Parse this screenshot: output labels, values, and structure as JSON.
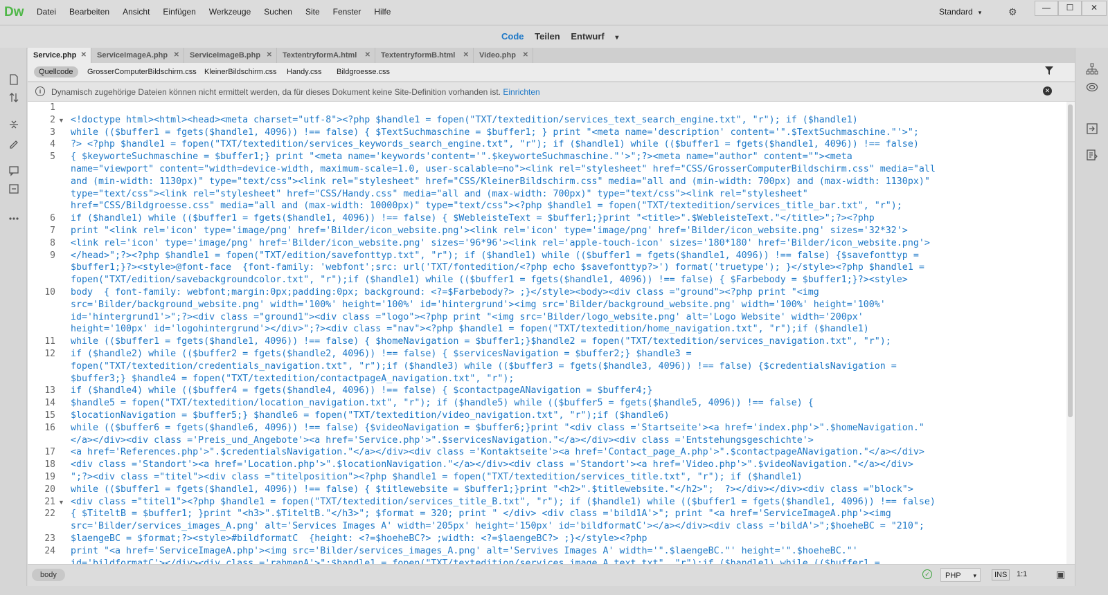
{
  "app": {
    "logo": "Dw"
  },
  "menu": [
    "Datei",
    "Bearbeiten",
    "Ansicht",
    "Einfügen",
    "Werkzeuge",
    "Suchen",
    "Site",
    "Fenster",
    "Hilfe"
  ],
  "workspace": {
    "label": "Standard",
    "caret": "▾",
    "sync_icon": "⚙"
  },
  "window_controls": {
    "minimize": "—",
    "maximize": "☐",
    "close": "✕"
  },
  "view_modes": {
    "code": "Code",
    "split": "Teilen",
    "design": "Entwurf",
    "caret": "▾"
  },
  "tabs": [
    {
      "label": "Service.php",
      "close": "✕"
    },
    {
      "label": "ServiceImageA.php",
      "close": "✕"
    },
    {
      "label": "ServiceImageB.php",
      "close": "✕"
    },
    {
      "label": "TextentryformA.html",
      "close": "✕"
    },
    {
      "label": "TextentryformB.html",
      "close": "✕"
    },
    {
      "label": "Video.php",
      "close": "✕"
    }
  ],
  "related_files": [
    "Quellcode",
    "GrosserComputerBildschirm.css",
    "KleinerBildschirm.css",
    "Handy.css",
    "Bildgroesse.css"
  ],
  "info_bar": {
    "icon": "i",
    "message": "Dynamisch zugehörige Dateien können nicht ermittelt werden, da für dieses Dokument keine Site-Definition vorhanden ist.",
    "link": "Einrichten",
    "close": "✕"
  },
  "code_lines": [
    {
      "num": "1",
      "fold": "",
      "text": ""
    },
    {
      "num": "2",
      "fold": "▼",
      "text": "<!doctype html><html><head><meta charset=\"utf-8\"><?php $handle1 = fopen(\"TXT/textedition/services_text_search_engine.txt\", \"r\"); if ($handle1)"
    },
    {
      "num": "3",
      "fold": "",
      "text": "while (($buffer1 = fgets($handle1, 4096)) !== false) { $TextSuchmaschine = $buffer1; } print \"<meta name='description' content='\".$TextSuchmaschine.\"'>\";"
    },
    {
      "num": "4",
      "fold": "",
      "text": "?> <?php $handle1 = fopen(\"TXT/textedition/services_keywords_search_engine.txt\", \"r\"); if ($handle1) while (($buffer1 = fgets($handle1, 4096)) !== false)"
    },
    {
      "num": "5",
      "fold": "",
      "text": "{ $keyworteSuchmaschine = $buffer1;} print \"<meta name='keywords'content='\".$keyworteSuchmaschine.\"'>\";?><meta name=\"author\" content=\"\"><meta"
    },
    {
      "num": "",
      "fold": "",
      "text": "name=\"viewport\" content=\"width=device-width, maximum-scale=1.0, user-scalable=no\"><link rel=\"stylesheet\" href=\"CSS/GrosserComputerBildschirm.css\" media=\"all"
    },
    {
      "num": "",
      "fold": "",
      "text": "and (min-width: 1130px)\" type=\"text/css\"><link rel=\"stylesheet\" href=\"CSS/KleinerBildschirm.css\" media=\"all and (min-width: 700px) and (max-width: 1130px)\""
    },
    {
      "num": "",
      "fold": "",
      "text": "type=\"text/css\"><link rel=\"stylesheet\" href=\"CSS/Handy.css\" media=\"all and (max-width: 700px)\" type=\"text/css\"><link rel=\"stylesheet\""
    },
    {
      "num": "",
      "fold": "",
      "text": "href=\"CSS/Bildgroesse.css\" media=\"all and (max-width: 10000px)\" type=\"text/css\"><?php $handle1 = fopen(\"TXT/textedition/services_title_bar.txt\", \"r\");"
    },
    {
      "num": "6",
      "fold": "",
      "text": "if ($handle1) while (($buffer1 = fgets($handle1, 4096)) !== false) { $WebleisteText = $buffer1;}print \"<title>\".$WebleisteText.\"</title>\";?><?php"
    },
    {
      "num": "7",
      "fold": "",
      "text": "print \"<link rel='icon' type='image/png' href='Bilder/icon_website.png'><link rel='icon' type='image/png' href='Bilder/icon_website.png' sizes='32*32'>"
    },
    {
      "num": "8",
      "fold": "",
      "text": "<link rel='icon' type='image/png' href='Bilder/icon_website.png' sizes='96*96'><link rel='apple-touch-icon' sizes='180*180' href='Bilder/icon_website.png'>"
    },
    {
      "num": "9",
      "fold": "",
      "text": "</head>\";?><?php $handle1 = fopen(\"TXT/edition/savefonttyp.txt\", \"r\"); if ($handle1) while (($buffer1 = fgets($handle1, 4096)) !== false) {$savefonttyp ="
    },
    {
      "num": "",
      "fold": "",
      "text": "$buffer1;}?><style>@font-face  {font-family: 'webfont';src: url('TXT/fontedition/<?php echo $savefonttyp?>') format('truetype'); }</style><?php $handle1 ="
    },
    {
      "num": "",
      "fold": "",
      "text": "fopen(\"TXT/edition/savebackgroundcolor.txt\", \"r\");if ($handle1) while (($buffer1 = fgets($handle1, 4096)) !== false) { $Farbebody = $buffer1;}?><style>"
    },
    {
      "num": "10",
      "fold": "",
      "text": "body  { font-family: webfont;margin:0px;padding:0px; background: <?=$Farbebody?> ;}</style><body><div class =\"ground\"><?php print \"<img"
    },
    {
      "num": "",
      "fold": "",
      "text": "src='Bilder/background_website.png' width='100%' height='100%' id='hintergrund'><img src='Bilder/background_website.png' width='100%' height='100%'"
    },
    {
      "num": "",
      "fold": "",
      "text": "id='hintergrund1'>\";?><div class =\"ground1\"><div class =\"logo\"><?php print \"<img src='Bilder/logo_website.png' alt='Logo Website' width='200px'"
    },
    {
      "num": "",
      "fold": "",
      "text": "height='100px' id='logohintergrund'></div>\";?><div class =\"nav\"><?php $handle1 = fopen(\"TXT/textedition/home_navigation.txt\", \"r\");if ($handle1)"
    },
    {
      "num": "11",
      "fold": "",
      "text": "while (($buffer1 = fgets($handle1, 4096)) !== false) { $homeNavigation = $buffer1;}$handle2 = fopen(\"TXT/textedition/services_navigation.txt\", \"r\");"
    },
    {
      "num": "12",
      "fold": "",
      "text": "if ($handle2) while (($buffer2 = fgets($handle2, 4096)) !== false) { $servicesNavigation = $buffer2;} $handle3 ="
    },
    {
      "num": "",
      "fold": "",
      "text": "fopen(\"TXT/textedition/credentials_navigation.txt\", \"r\");if ($handle3) while (($buffer3 = fgets($handle3, 4096)) !== false) {$credentialsNavigation ="
    },
    {
      "num": "",
      "fold": "",
      "text": "$buffer3;} $handle4 = fopen(\"TXT/textedition/contactpageA_navigation.txt\", \"r\");"
    },
    {
      "num": "13",
      "fold": "",
      "text": "if ($handle4) while (($buffer4 = fgets($handle4, 4096)) !== false) { $contactpageANavigation = $buffer4;}"
    },
    {
      "num": "14",
      "fold": "",
      "text": "$handle5 = fopen(\"TXT/textedition/location_navigation.txt\", \"r\"); if ($handle5) while (($buffer5 = fgets($handle5, 4096)) !== false) {"
    },
    {
      "num": "15",
      "fold": "",
      "text": "$locationNavigation = $buffer5;} $handle6 = fopen(\"TXT/textedition/video_navigation.txt\", \"r\");if ($handle6)"
    },
    {
      "num": "16",
      "fold": "",
      "text": "while (($buffer6 = fgets($handle6, 4096)) !== false) {$videoNavigation = $buffer6;}print \"<div class ='Startseite'><a href='index.php'>\".$homeNavigation.\""
    },
    {
      "num": "",
      "fold": "",
      "text": "</a></div><div class ='Preis_und_Angebote'><a href='Service.php'>\".$servicesNavigation.\"</a></div><div class ='Entstehungsgeschichte'>"
    },
    {
      "num": "17",
      "fold": "",
      "text": "<a href='References.php'>\".$credentialsNavigation.\"</a></div><div class ='Kontaktseite'><a href='Contact_page_A.php'>\".$contactpageANavigation.\"</a></div>"
    },
    {
      "num": "18",
      "fold": "",
      "text": "<div class ='Standort'><a href='Location.php'>\".$locationNavigation.\"</a></div><div class ='Standort'><a href='Video.php'>\".$videoNavigation.\"</a></div>"
    },
    {
      "num": "19",
      "fold": "",
      "text": "\";?><div class =\"titel\"><div class =\"titelposition\"><?php $handle1 = fopen(\"TXT/textedition/services_title.txt\", \"r\"); if ($handle1)"
    },
    {
      "num": "20",
      "fold": "",
      "text": "while (($buffer1 = fgets($handle1, 4096)) !== false) { $titlewebsite = $buffer1;}print \"<h2>\".$titlewebsite.\"</h2>\";  ?></div></div><div class =\"block\">"
    },
    {
      "num": "21",
      "fold": "▼",
      "text": "<div class =\"titel1\"><?php $handle1 = fopen(\"TXT/textedition/services_title_B.txt\", \"r\"); if ($handle1) while (($buffer1 = fgets($handle1, 4096)) !== false)"
    },
    {
      "num": "22",
      "fold": "",
      "text": "{ $TiteltB = $buffer1; }print \"<h3>\".$TiteltB.\"</h3>\"; $format = 320; print \" </div> <div class ='bild1A'>\"; print \"<a href='ServiceImageA.php'><img"
    },
    {
      "num": "",
      "fold": "",
      "text": "src='Bilder/services_images_A.png' alt='Services Images A' width='205px' height='150px' id='bildformatC'></a></div><div class ='bildA'>\";$hoeheBC = \"210\";"
    },
    {
      "num": "23",
      "fold": "",
      "text": "$laengeBC = $format;?><style>#bildformatC  {height: <?=$hoeheBC?> ;width: <?=$laengeBC?> ;}</style><?php"
    },
    {
      "num": "24",
      "fold": "",
      "text": "print \"<a href='ServiceImageA.php'><img src='Bilder/services_images_A.png' alt='Servives Images A' width='\".$laengeBC.\"' height='\".$hoeheBC.\"'"
    },
    {
      "num": "",
      "fold": "",
      "text": "id='bildformatC'></div><div class ='rahmenA'>\";$handle1 = fopen(\"TXT/textedition/services_image_A_text.txt\", \"r\");if ($handle1) while (($buffer1 ="
    }
  ],
  "status": {
    "tag": "body",
    "ok_icon": "✓",
    "language": "PHP",
    "caret": "▾",
    "mode": "INS",
    "position": "1:1",
    "preview_icon": "▣"
  }
}
